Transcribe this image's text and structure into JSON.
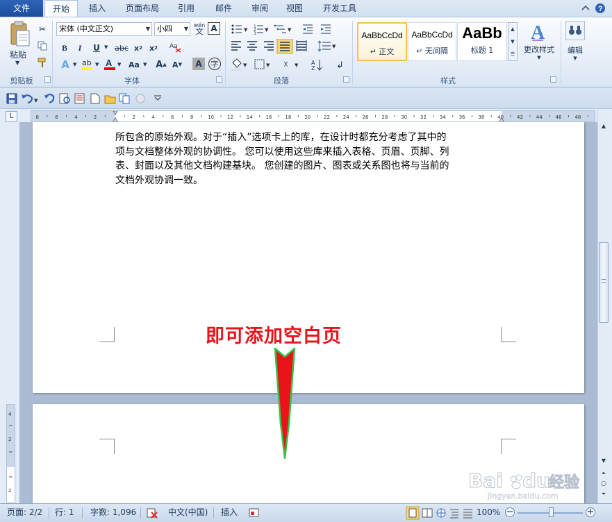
{
  "tabs": {
    "file": "文件",
    "items": [
      "开始",
      "插入",
      "页面布局",
      "引用",
      "邮件",
      "审阅",
      "视图",
      "开发工具"
    ],
    "active_index": 0
  },
  "clipboard": {
    "paste": "粘贴",
    "group": "剪贴板"
  },
  "font": {
    "name": "宋体 (中文正文)",
    "size": "小四",
    "group": "字体",
    "wen_glyph": "wén"
  },
  "paragraph": {
    "group": "段落"
  },
  "styles": {
    "group": "样式",
    "items": [
      {
        "preview": "AaBbCcDd",
        "name": "↵ 正文"
      },
      {
        "preview": "AaBbCcDd",
        "name": "↵ 无间隔"
      },
      {
        "preview": "AaBb",
        "name": "标题 1"
      }
    ],
    "change": "更改样式"
  },
  "editing": {
    "label": "编辑"
  },
  "ruler": {
    "h_ticks": [
      "8",
      "6",
      "4",
      "2",
      "",
      "2",
      "4",
      "6",
      "8",
      "10",
      "12",
      "14",
      "16",
      "18",
      "20",
      "22",
      "24",
      "26",
      "28",
      "30",
      "32",
      "34",
      "36",
      "38",
      "40",
      "42",
      "44",
      "46",
      "48"
    ],
    "v_ticks": [
      "4",
      "",
      "2",
      "",
      "",
      "2"
    ]
  },
  "document": {
    "partial_line": "",
    "lines": [
      "所包含的原始外观。对于“插入”选项卡上的库，在设计时都充分考虑了其中的",
      "项与文档整体外观的协调性。 您可以使用这些库来插入表格、页眉、页脚、列",
      "表、封面以及其他文档构建基块。 您创建的图片、图表或关系图也将与当前的",
      "文档外观协调一致。"
    ]
  },
  "annotation": {
    "text": "即可添加空白页",
    "color": "#e8141a",
    "arrow_color": "#e8141a"
  },
  "status": {
    "page": "页面: 2/2",
    "line": "行: 1",
    "words": "字数: 1,096",
    "language": "中文(中国)",
    "mode": "插入",
    "zoom": "100%"
  },
  "watermark": {
    "brand": "Bai",
    "brand2": "du",
    "suffix": "经验",
    "url": "jingyan.baidu.com"
  },
  "colors": {
    "accent": "#2b5797",
    "highlight": "#ffff00",
    "font_red": "#ff0000"
  }
}
